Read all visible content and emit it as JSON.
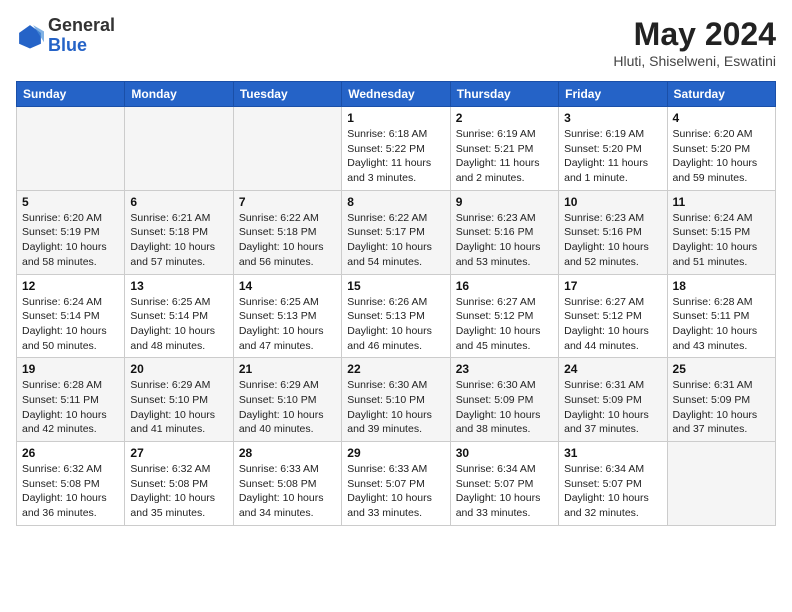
{
  "header": {
    "logo_general": "General",
    "logo_blue": "Blue",
    "title": "May 2024",
    "location": "Hluti, Shiselweni, Eswatini"
  },
  "weekdays": [
    "Sunday",
    "Monday",
    "Tuesday",
    "Wednesday",
    "Thursday",
    "Friday",
    "Saturday"
  ],
  "weeks": [
    [
      {
        "day": "",
        "info": ""
      },
      {
        "day": "",
        "info": ""
      },
      {
        "day": "",
        "info": ""
      },
      {
        "day": "1",
        "info": "Sunrise: 6:18 AM\nSunset: 5:22 PM\nDaylight: 11 hours and 3 minutes."
      },
      {
        "day": "2",
        "info": "Sunrise: 6:19 AM\nSunset: 5:21 PM\nDaylight: 11 hours and 2 minutes."
      },
      {
        "day": "3",
        "info": "Sunrise: 6:19 AM\nSunset: 5:20 PM\nDaylight: 11 hours and 1 minute."
      },
      {
        "day": "4",
        "info": "Sunrise: 6:20 AM\nSunset: 5:20 PM\nDaylight: 10 hours and 59 minutes."
      }
    ],
    [
      {
        "day": "5",
        "info": "Sunrise: 6:20 AM\nSunset: 5:19 PM\nDaylight: 10 hours and 58 minutes."
      },
      {
        "day": "6",
        "info": "Sunrise: 6:21 AM\nSunset: 5:18 PM\nDaylight: 10 hours and 57 minutes."
      },
      {
        "day": "7",
        "info": "Sunrise: 6:22 AM\nSunset: 5:18 PM\nDaylight: 10 hours and 56 minutes."
      },
      {
        "day": "8",
        "info": "Sunrise: 6:22 AM\nSunset: 5:17 PM\nDaylight: 10 hours and 54 minutes."
      },
      {
        "day": "9",
        "info": "Sunrise: 6:23 AM\nSunset: 5:16 PM\nDaylight: 10 hours and 53 minutes."
      },
      {
        "day": "10",
        "info": "Sunrise: 6:23 AM\nSunset: 5:16 PM\nDaylight: 10 hours and 52 minutes."
      },
      {
        "day": "11",
        "info": "Sunrise: 6:24 AM\nSunset: 5:15 PM\nDaylight: 10 hours and 51 minutes."
      }
    ],
    [
      {
        "day": "12",
        "info": "Sunrise: 6:24 AM\nSunset: 5:14 PM\nDaylight: 10 hours and 50 minutes."
      },
      {
        "day": "13",
        "info": "Sunrise: 6:25 AM\nSunset: 5:14 PM\nDaylight: 10 hours and 48 minutes."
      },
      {
        "day": "14",
        "info": "Sunrise: 6:25 AM\nSunset: 5:13 PM\nDaylight: 10 hours and 47 minutes."
      },
      {
        "day": "15",
        "info": "Sunrise: 6:26 AM\nSunset: 5:13 PM\nDaylight: 10 hours and 46 minutes."
      },
      {
        "day": "16",
        "info": "Sunrise: 6:27 AM\nSunset: 5:12 PM\nDaylight: 10 hours and 45 minutes."
      },
      {
        "day": "17",
        "info": "Sunrise: 6:27 AM\nSunset: 5:12 PM\nDaylight: 10 hours and 44 minutes."
      },
      {
        "day": "18",
        "info": "Sunrise: 6:28 AM\nSunset: 5:11 PM\nDaylight: 10 hours and 43 minutes."
      }
    ],
    [
      {
        "day": "19",
        "info": "Sunrise: 6:28 AM\nSunset: 5:11 PM\nDaylight: 10 hours and 42 minutes."
      },
      {
        "day": "20",
        "info": "Sunrise: 6:29 AM\nSunset: 5:10 PM\nDaylight: 10 hours and 41 minutes."
      },
      {
        "day": "21",
        "info": "Sunrise: 6:29 AM\nSunset: 5:10 PM\nDaylight: 10 hours and 40 minutes."
      },
      {
        "day": "22",
        "info": "Sunrise: 6:30 AM\nSunset: 5:10 PM\nDaylight: 10 hours and 39 minutes."
      },
      {
        "day": "23",
        "info": "Sunrise: 6:30 AM\nSunset: 5:09 PM\nDaylight: 10 hours and 38 minutes."
      },
      {
        "day": "24",
        "info": "Sunrise: 6:31 AM\nSunset: 5:09 PM\nDaylight: 10 hours and 37 minutes."
      },
      {
        "day": "25",
        "info": "Sunrise: 6:31 AM\nSunset: 5:09 PM\nDaylight: 10 hours and 37 minutes."
      }
    ],
    [
      {
        "day": "26",
        "info": "Sunrise: 6:32 AM\nSunset: 5:08 PM\nDaylight: 10 hours and 36 minutes."
      },
      {
        "day": "27",
        "info": "Sunrise: 6:32 AM\nSunset: 5:08 PM\nDaylight: 10 hours and 35 minutes."
      },
      {
        "day": "28",
        "info": "Sunrise: 6:33 AM\nSunset: 5:08 PM\nDaylight: 10 hours and 34 minutes."
      },
      {
        "day": "29",
        "info": "Sunrise: 6:33 AM\nSunset: 5:07 PM\nDaylight: 10 hours and 33 minutes."
      },
      {
        "day": "30",
        "info": "Sunrise: 6:34 AM\nSunset: 5:07 PM\nDaylight: 10 hours and 33 minutes."
      },
      {
        "day": "31",
        "info": "Sunrise: 6:34 AM\nSunset: 5:07 PM\nDaylight: 10 hours and 32 minutes."
      },
      {
        "day": "",
        "info": ""
      }
    ]
  ]
}
